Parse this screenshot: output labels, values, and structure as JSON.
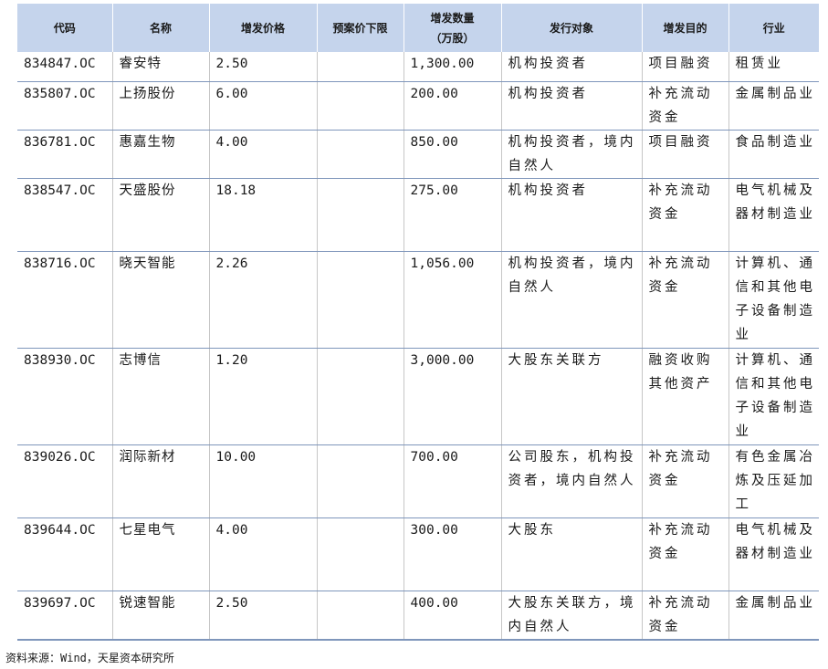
{
  "table": {
    "headers": [
      "代码",
      "名称",
      "增发价格",
      "预案价下限",
      "增发数量\n（万股）",
      "发行对象",
      "增发目的",
      "行业"
    ],
    "rows": [
      [
        "834847.OC",
        "睿安特",
        "2.50",
        "",
        "1,300.00",
        "机构投资者",
        "项目融资",
        "租赁业"
      ],
      [
        "835807.OC",
        "上扬股份",
        "6.00",
        "",
        "200.00",
        "机构投资者",
        "补充流动资金",
        "金属制品业"
      ],
      [
        "836781.OC",
        "惠嘉生物",
        "4.00",
        "",
        "850.00",
        "机构投资者，境内自然人",
        "项目融资",
        "食品制造业"
      ],
      [
        "838547.OC",
        "天盛股份",
        "18.18",
        "",
        "275.00",
        "机构投资者",
        "补充流动资金",
        "电气机械及器材制造业"
      ],
      [
        "838716.OC",
        "晓天智能",
        "2.26",
        "",
        "1,056.00",
        "机构投资者，境内自然人",
        "补充流动资金",
        "计算机、通信和其他电子设备制造业"
      ],
      [
        "838930.OC",
        "志博信",
        "1.20",
        "",
        "3,000.00",
        "大股东关联方",
        "融资收购其他资产",
        "计算机、通信和其他电子设备制造业"
      ],
      [
        "839026.OC",
        "润际新材",
        "10.00",
        "",
        "700.00",
        "公司股东，机构投资者，境内自然人",
        "补充流动资金",
        "有色金属冶炼及压延加工"
      ],
      [
        "839644.OC",
        "七星电气",
        "4.00",
        "",
        "300.00",
        "大股东",
        "补充流动资金",
        "电气机械及器材制造业"
      ],
      [
        "839697.OC",
        "锐速智能",
        "2.50",
        "",
        "400.00",
        "大股东关联方，境内自然人",
        "补充流动资金",
        "金属制品业"
      ]
    ]
  },
  "footnote": "资料来源：Wind，天星资本研究所"
}
